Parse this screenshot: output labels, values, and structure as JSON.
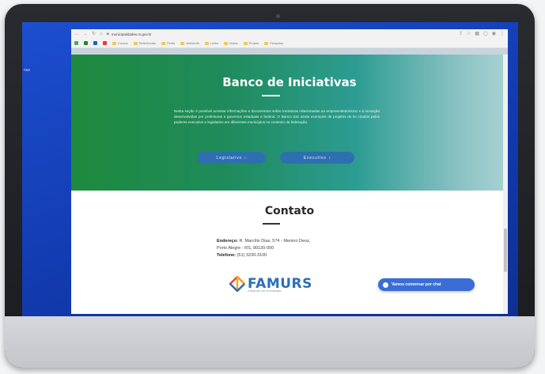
{
  "browser": {
    "url": "municipalidades.rs.gov.br",
    "bookmarks": [
      "Cursos",
      "Referências",
      "Pedal",
      "Ambiente",
      "Leitor",
      "Notas",
      "Projeto",
      "Pesquisa"
    ]
  },
  "desktop": {
    "label": "nes"
  },
  "hero": {
    "title": "Banco de Iniciativas",
    "text": "Nesta seção é possível acessar informações e documentos sobre iniciativas relacionadas ao empreendedorismo e à inovação desenvolvidas por prefeituras e governos estaduais e federal. O Banco traz ainda exemplos de projetos de lei criados pelos poderes executivo e legislativo em diferentes municípios no contexto da federação.",
    "btn_legislativo": "Legislativo",
    "btn_executivo": "Executivo",
    "chevron": "›",
    "bg_color": "#1e8a3e"
  },
  "contato": {
    "title": "Contato",
    "endereco_label": "Endereço:",
    "endereco_value": "R. Marcílio Dias, 574 - Menino Deus,",
    "cidade": "Porto Alegre - RS, 90130-000",
    "telefone_label": "Telefone:",
    "telefone_value": "(51) 3230-3100"
  },
  "logo": {
    "name": "FAMURS",
    "subtitle": "A força que une os municípios"
  },
  "chat": {
    "label": "Vamos conversar por chat"
  },
  "colors": {
    "accent_blue": "#3a6ed6",
    "button_blue": "#2e6fb0"
  }
}
